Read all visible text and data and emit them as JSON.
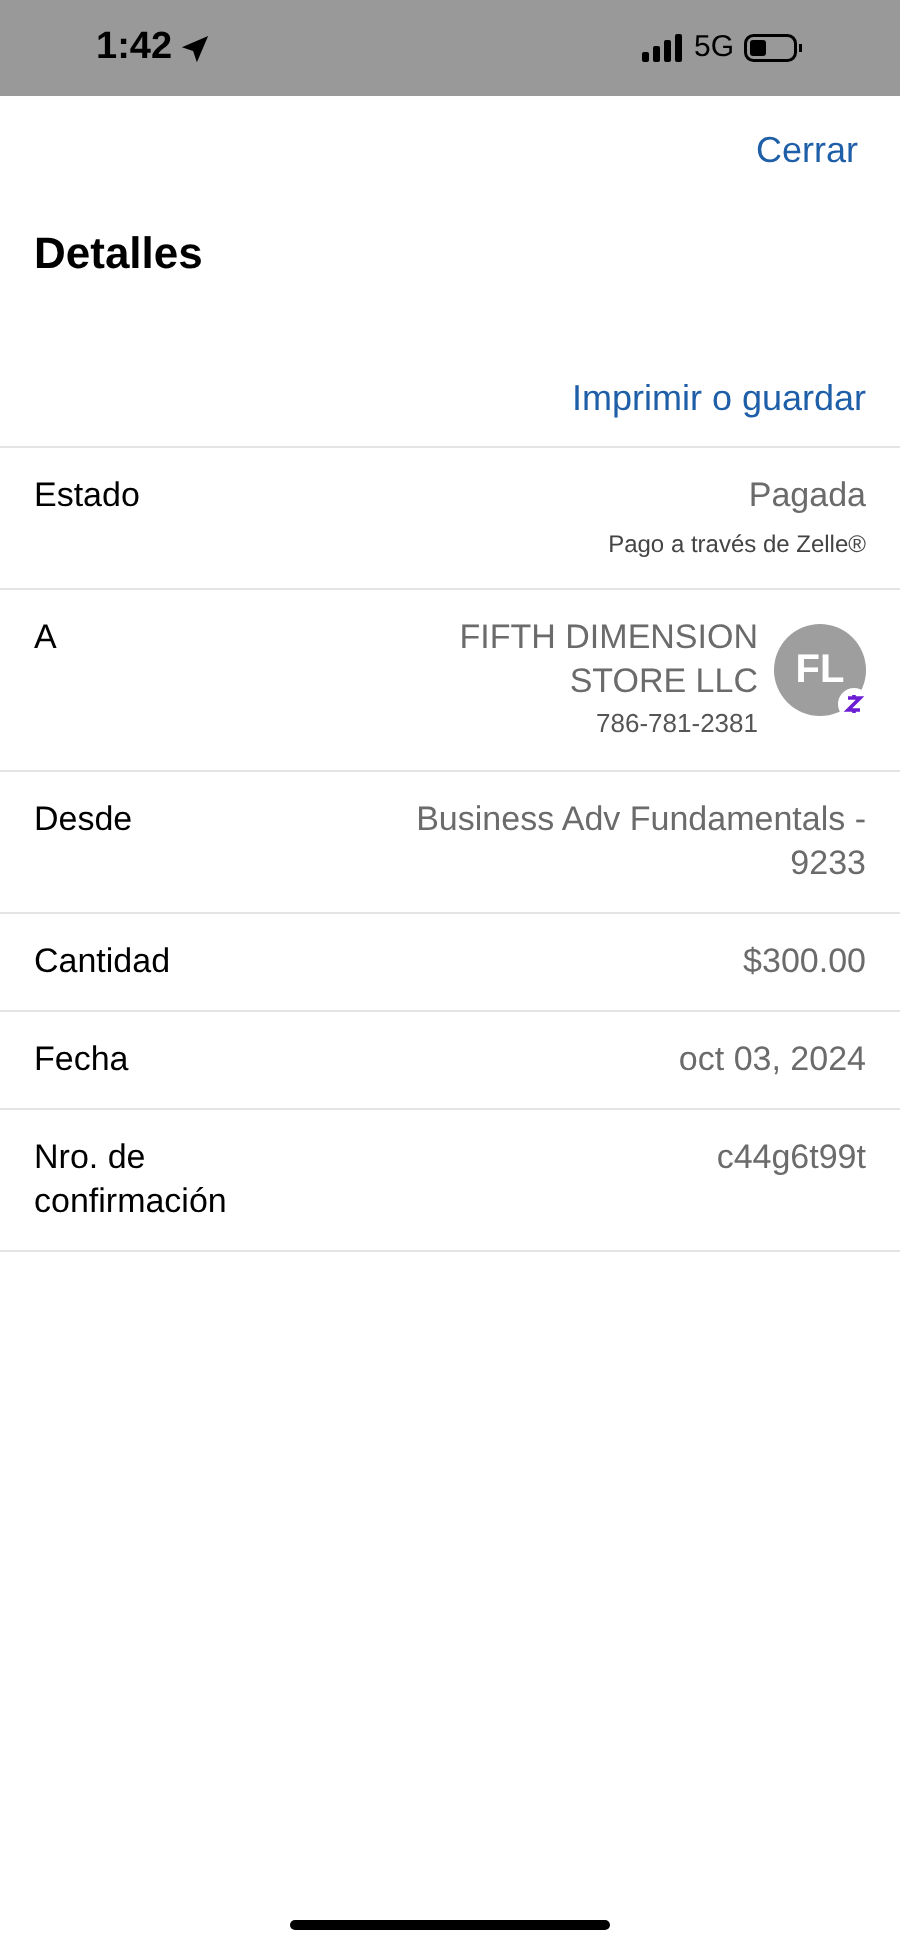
{
  "status_bar": {
    "time": "1:42",
    "network": "5G"
  },
  "header": {
    "close": "Cerrar",
    "title": "Detalles",
    "print": "Imprimir o guardar"
  },
  "rows": [
    {
      "kind": "note",
      "label": "Estado",
      "value": "Pagada",
      "note": "Pago a través de Zelle®"
    },
    {
      "kind": "contact",
      "label": "A",
      "value": "FIFTH DIMENSION STORE LLC",
      "note": "786-781-2381",
      "initials": "FL"
    },
    {
      "kind": "plain",
      "label": "Desde",
      "value": "Business Adv Fundamentals - 9233"
    },
    {
      "kind": "plain",
      "label": "Cantidad",
      "value": "$300.00"
    },
    {
      "kind": "plain",
      "label": "Fecha",
      "value": "oct 03, 2024"
    },
    {
      "kind": "plain",
      "label": "Nro. de confirmación",
      "value": "c44g6t99t"
    }
  ]
}
